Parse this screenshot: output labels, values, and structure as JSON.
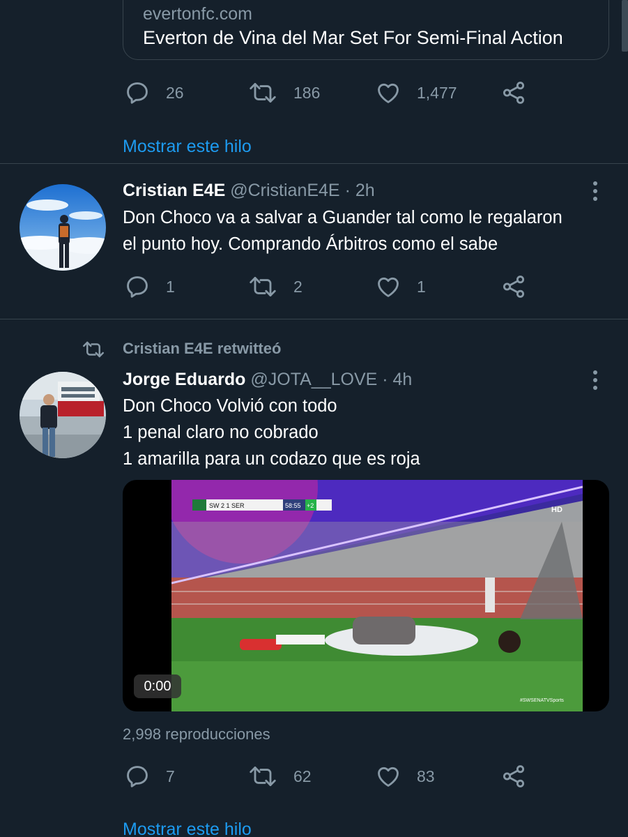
{
  "link_card": {
    "domain": "evertonfc.com",
    "title": "Everton de Vina del Mar Set For Semi-Final Action"
  },
  "tweet0": {
    "replies": "26",
    "retweets": "186",
    "likes": "1,477",
    "show_thread": "Mostrar este hilo"
  },
  "tweet1": {
    "name": "Cristian E4E",
    "handle": "@CristianE4E",
    "time": "· 2h",
    "lines": [
      "Don Choco va a salvar a Guander tal como le regalaron",
      "el punto hoy. Comprando Árbitros como el sabe"
    ],
    "replies": "1",
    "retweets": "2",
    "likes": "1"
  },
  "tweet2": {
    "retweeted_by": "Cristian E4E retwitteó",
    "name": "Jorge Eduardo",
    "handle": "@JOTA__LOVE",
    "time": "· 4h",
    "lines": [
      "Don Choco Volvió con todo",
      "1 penal claro no cobrado",
      "1 amarilla para un codazo que es roja"
    ],
    "video": {
      "timecode": "0:00",
      "scorebug": "SW 2 1 SER",
      "clock": "58:55",
      "added": "+2",
      "badge": "HD",
      "watermark": "#SWSENATVSports"
    },
    "views": "2,998 reproducciones",
    "replies": "7",
    "retweets": "62",
    "likes": "83",
    "show_thread": "Mostrar este hilo"
  },
  "colors": {
    "background": "#15202b",
    "muted": "#8899a6",
    "link": "#1d9bf0",
    "border": "#38444d"
  },
  "icons": [
    "reply-icon",
    "retweet-icon",
    "like-icon",
    "share-icon",
    "more-icon",
    "retweeted-icon"
  ]
}
